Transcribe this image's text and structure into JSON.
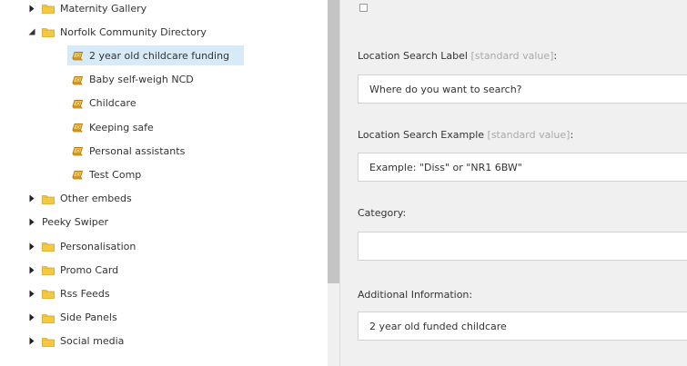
{
  "tree": {
    "items": [
      {
        "label": "Maternity Gallery",
        "depth": 1,
        "arrow": "collapsed",
        "icon": "folder-icon",
        "selected": false
      },
      {
        "label": "Norfolk Community Directory",
        "depth": 1,
        "arrow": "expanded",
        "icon": "folder-icon",
        "selected": false
      },
      {
        "label": "2 year old childcare funding",
        "depth": 2,
        "arrow": "none",
        "icon": "component-icon",
        "selected": true
      },
      {
        "label": "Baby self-weigh NCD",
        "depth": 2,
        "arrow": "none",
        "icon": "component-icon",
        "selected": false
      },
      {
        "label": "Childcare",
        "depth": 2,
        "arrow": "none",
        "icon": "component-icon",
        "selected": false
      },
      {
        "label": "Keeping safe",
        "depth": 2,
        "arrow": "none",
        "icon": "component-icon",
        "selected": false
      },
      {
        "label": "Personal assistants",
        "depth": 2,
        "arrow": "none",
        "icon": "component-icon",
        "selected": false
      },
      {
        "label": "Test Comp",
        "depth": 2,
        "arrow": "none",
        "icon": "component-icon",
        "selected": false
      },
      {
        "label": "Other embeds",
        "depth": 1,
        "arrow": "collapsed",
        "icon": "folder-icon",
        "selected": false
      },
      {
        "label": "Peeky Swiper",
        "depth": 1,
        "arrow": "collapsed",
        "icon": "none",
        "selected": false
      },
      {
        "label": "Personalisation",
        "depth": 1,
        "arrow": "collapsed",
        "icon": "folder-icon",
        "selected": false
      },
      {
        "label": "Promo Card",
        "depth": 1,
        "arrow": "collapsed",
        "icon": "folder-icon",
        "selected": false
      },
      {
        "label": "Rss Feeds",
        "depth": 1,
        "arrow": "collapsed",
        "icon": "folder-icon",
        "selected": false
      },
      {
        "label": "Side Panels",
        "depth": 1,
        "arrow": "collapsed",
        "icon": "folder-icon",
        "selected": false
      },
      {
        "label": "Social media",
        "depth": 1,
        "arrow": "collapsed",
        "icon": "folder-icon",
        "selected": false
      }
    ]
  },
  "fields": {
    "location_search_label": {
      "label": "Location Search Label",
      "suffix": "[standard value]",
      "colon": ":",
      "value": "Where do you want to search?"
    },
    "location_search_example": {
      "label": "Location Search Example",
      "suffix": "[standard value]",
      "colon": ":",
      "value": "Example: \"Diss\" or \"NR1 6BW\""
    },
    "category": {
      "label": "Category:",
      "value": ""
    },
    "additional_information": {
      "label": "Additional Information:",
      "value": "2 year old funded childcare"
    }
  },
  "colors": {
    "selected_row": "#d7eaf8",
    "folder": "#f5c842",
    "panel_bg": "#f0f0f0"
  }
}
